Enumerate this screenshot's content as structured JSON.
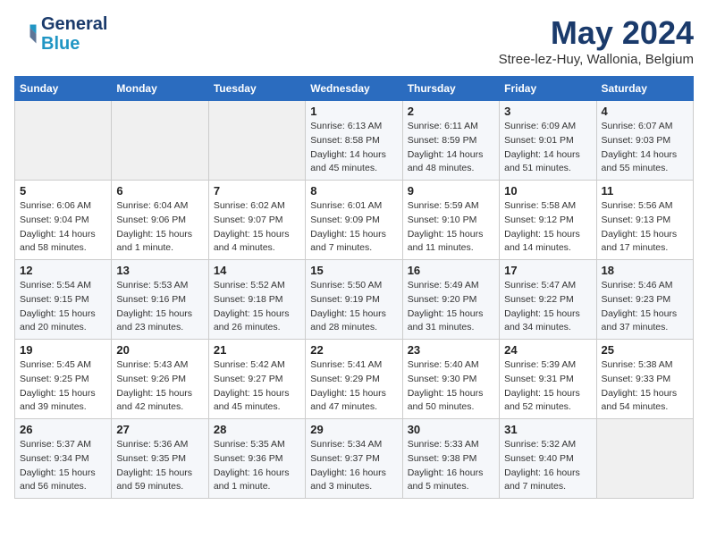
{
  "header": {
    "logo_line1": "General",
    "logo_line2": "Blue",
    "month_year": "May 2024",
    "location": "Stree-lez-Huy, Wallonia, Belgium"
  },
  "days_of_week": [
    "Sunday",
    "Monday",
    "Tuesday",
    "Wednesday",
    "Thursday",
    "Friday",
    "Saturday"
  ],
  "weeks": [
    [
      {
        "day": "",
        "info": ""
      },
      {
        "day": "",
        "info": ""
      },
      {
        "day": "",
        "info": ""
      },
      {
        "day": "1",
        "sunrise": "Sunrise: 6:13 AM",
        "sunset": "Sunset: 8:58 PM",
        "daylight": "Daylight: 14 hours and 45 minutes."
      },
      {
        "day": "2",
        "sunrise": "Sunrise: 6:11 AM",
        "sunset": "Sunset: 8:59 PM",
        "daylight": "Daylight: 14 hours and 48 minutes."
      },
      {
        "day": "3",
        "sunrise": "Sunrise: 6:09 AM",
        "sunset": "Sunset: 9:01 PM",
        "daylight": "Daylight: 14 hours and 51 minutes."
      },
      {
        "day": "4",
        "sunrise": "Sunrise: 6:07 AM",
        "sunset": "Sunset: 9:03 PM",
        "daylight": "Daylight: 14 hours and 55 minutes."
      }
    ],
    [
      {
        "day": "5",
        "sunrise": "Sunrise: 6:06 AM",
        "sunset": "Sunset: 9:04 PM",
        "daylight": "Daylight: 14 hours and 58 minutes."
      },
      {
        "day": "6",
        "sunrise": "Sunrise: 6:04 AM",
        "sunset": "Sunset: 9:06 PM",
        "daylight": "Daylight: 15 hours and 1 minute."
      },
      {
        "day": "7",
        "sunrise": "Sunrise: 6:02 AM",
        "sunset": "Sunset: 9:07 PM",
        "daylight": "Daylight: 15 hours and 4 minutes."
      },
      {
        "day": "8",
        "sunrise": "Sunrise: 6:01 AM",
        "sunset": "Sunset: 9:09 PM",
        "daylight": "Daylight: 15 hours and 7 minutes."
      },
      {
        "day": "9",
        "sunrise": "Sunrise: 5:59 AM",
        "sunset": "Sunset: 9:10 PM",
        "daylight": "Daylight: 15 hours and 11 minutes."
      },
      {
        "day": "10",
        "sunrise": "Sunrise: 5:58 AM",
        "sunset": "Sunset: 9:12 PM",
        "daylight": "Daylight: 15 hours and 14 minutes."
      },
      {
        "day": "11",
        "sunrise": "Sunrise: 5:56 AM",
        "sunset": "Sunset: 9:13 PM",
        "daylight": "Daylight: 15 hours and 17 minutes."
      }
    ],
    [
      {
        "day": "12",
        "sunrise": "Sunrise: 5:54 AM",
        "sunset": "Sunset: 9:15 PM",
        "daylight": "Daylight: 15 hours and 20 minutes."
      },
      {
        "day": "13",
        "sunrise": "Sunrise: 5:53 AM",
        "sunset": "Sunset: 9:16 PM",
        "daylight": "Daylight: 15 hours and 23 minutes."
      },
      {
        "day": "14",
        "sunrise": "Sunrise: 5:52 AM",
        "sunset": "Sunset: 9:18 PM",
        "daylight": "Daylight: 15 hours and 26 minutes."
      },
      {
        "day": "15",
        "sunrise": "Sunrise: 5:50 AM",
        "sunset": "Sunset: 9:19 PM",
        "daylight": "Daylight: 15 hours and 28 minutes."
      },
      {
        "day": "16",
        "sunrise": "Sunrise: 5:49 AM",
        "sunset": "Sunset: 9:20 PM",
        "daylight": "Daylight: 15 hours and 31 minutes."
      },
      {
        "day": "17",
        "sunrise": "Sunrise: 5:47 AM",
        "sunset": "Sunset: 9:22 PM",
        "daylight": "Daylight: 15 hours and 34 minutes."
      },
      {
        "day": "18",
        "sunrise": "Sunrise: 5:46 AM",
        "sunset": "Sunset: 9:23 PM",
        "daylight": "Daylight: 15 hours and 37 minutes."
      }
    ],
    [
      {
        "day": "19",
        "sunrise": "Sunrise: 5:45 AM",
        "sunset": "Sunset: 9:25 PM",
        "daylight": "Daylight: 15 hours and 39 minutes."
      },
      {
        "day": "20",
        "sunrise": "Sunrise: 5:43 AM",
        "sunset": "Sunset: 9:26 PM",
        "daylight": "Daylight: 15 hours and 42 minutes."
      },
      {
        "day": "21",
        "sunrise": "Sunrise: 5:42 AM",
        "sunset": "Sunset: 9:27 PM",
        "daylight": "Daylight: 15 hours and 45 minutes."
      },
      {
        "day": "22",
        "sunrise": "Sunrise: 5:41 AM",
        "sunset": "Sunset: 9:29 PM",
        "daylight": "Daylight: 15 hours and 47 minutes."
      },
      {
        "day": "23",
        "sunrise": "Sunrise: 5:40 AM",
        "sunset": "Sunset: 9:30 PM",
        "daylight": "Daylight: 15 hours and 50 minutes."
      },
      {
        "day": "24",
        "sunrise": "Sunrise: 5:39 AM",
        "sunset": "Sunset: 9:31 PM",
        "daylight": "Daylight: 15 hours and 52 minutes."
      },
      {
        "day": "25",
        "sunrise": "Sunrise: 5:38 AM",
        "sunset": "Sunset: 9:33 PM",
        "daylight": "Daylight: 15 hours and 54 minutes."
      }
    ],
    [
      {
        "day": "26",
        "sunrise": "Sunrise: 5:37 AM",
        "sunset": "Sunset: 9:34 PM",
        "daylight": "Daylight: 15 hours and 56 minutes."
      },
      {
        "day": "27",
        "sunrise": "Sunrise: 5:36 AM",
        "sunset": "Sunset: 9:35 PM",
        "daylight": "Daylight: 15 hours and 59 minutes."
      },
      {
        "day": "28",
        "sunrise": "Sunrise: 5:35 AM",
        "sunset": "Sunset: 9:36 PM",
        "daylight": "Daylight: 16 hours and 1 minute."
      },
      {
        "day": "29",
        "sunrise": "Sunrise: 5:34 AM",
        "sunset": "Sunset: 9:37 PM",
        "daylight": "Daylight: 16 hours and 3 minutes."
      },
      {
        "day": "30",
        "sunrise": "Sunrise: 5:33 AM",
        "sunset": "Sunset: 9:38 PM",
        "daylight": "Daylight: 16 hours and 5 minutes."
      },
      {
        "day": "31",
        "sunrise": "Sunrise: 5:32 AM",
        "sunset": "Sunset: 9:40 PM",
        "daylight": "Daylight: 16 hours and 7 minutes."
      },
      {
        "day": "",
        "info": ""
      }
    ]
  ]
}
